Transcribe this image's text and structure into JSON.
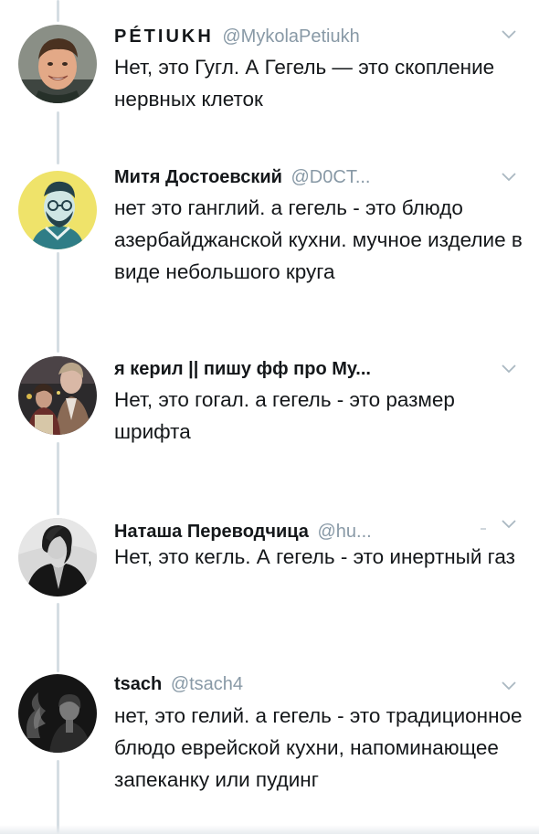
{
  "tweets": [
    {
      "name": "PÉTIUKH",
      "handle": "@MykolaPetiukh",
      "text": "Нет, это Гугл. А Гегель — это скопление нервных клеток",
      "avatar_icon": "avatar-photo-smiling-man"
    },
    {
      "name": "Митя Достоевский",
      "handle": "@D0CT...",
      "text": "нет это ганглий. а гегель - это блюдо азербайджанской кухни. мучное изделие в виде небольшого круга",
      "avatar_icon": "avatar-illustration-teal-on-yellow"
    },
    {
      "name": "я керил || пишу фф про Му...",
      "handle": "",
      "text": "Нет, это гогал. а гегель - это размер шрифта",
      "avatar_icon": "avatar-photo-two-people"
    },
    {
      "name": "Наташа Переводчица",
      "handle": "@hu...",
      "text": "Нет, это кегль. А гегель - это инертный газ",
      "avatar_icon": "avatar-photo-woman-bw"
    },
    {
      "name": "tsach",
      "handle": "@tsach4",
      "text": "нет, это гелий. а гегель - это традиционное блюдо еврейской кухни, напоминающее запеканку или пудинг",
      "avatar_icon": "avatar-photo-smoke-bw"
    }
  ],
  "colors": {
    "text": "#14171a",
    "handle": "#8899a6",
    "thread_line": "#d5dde3",
    "chevron": "#aab8c2"
  }
}
